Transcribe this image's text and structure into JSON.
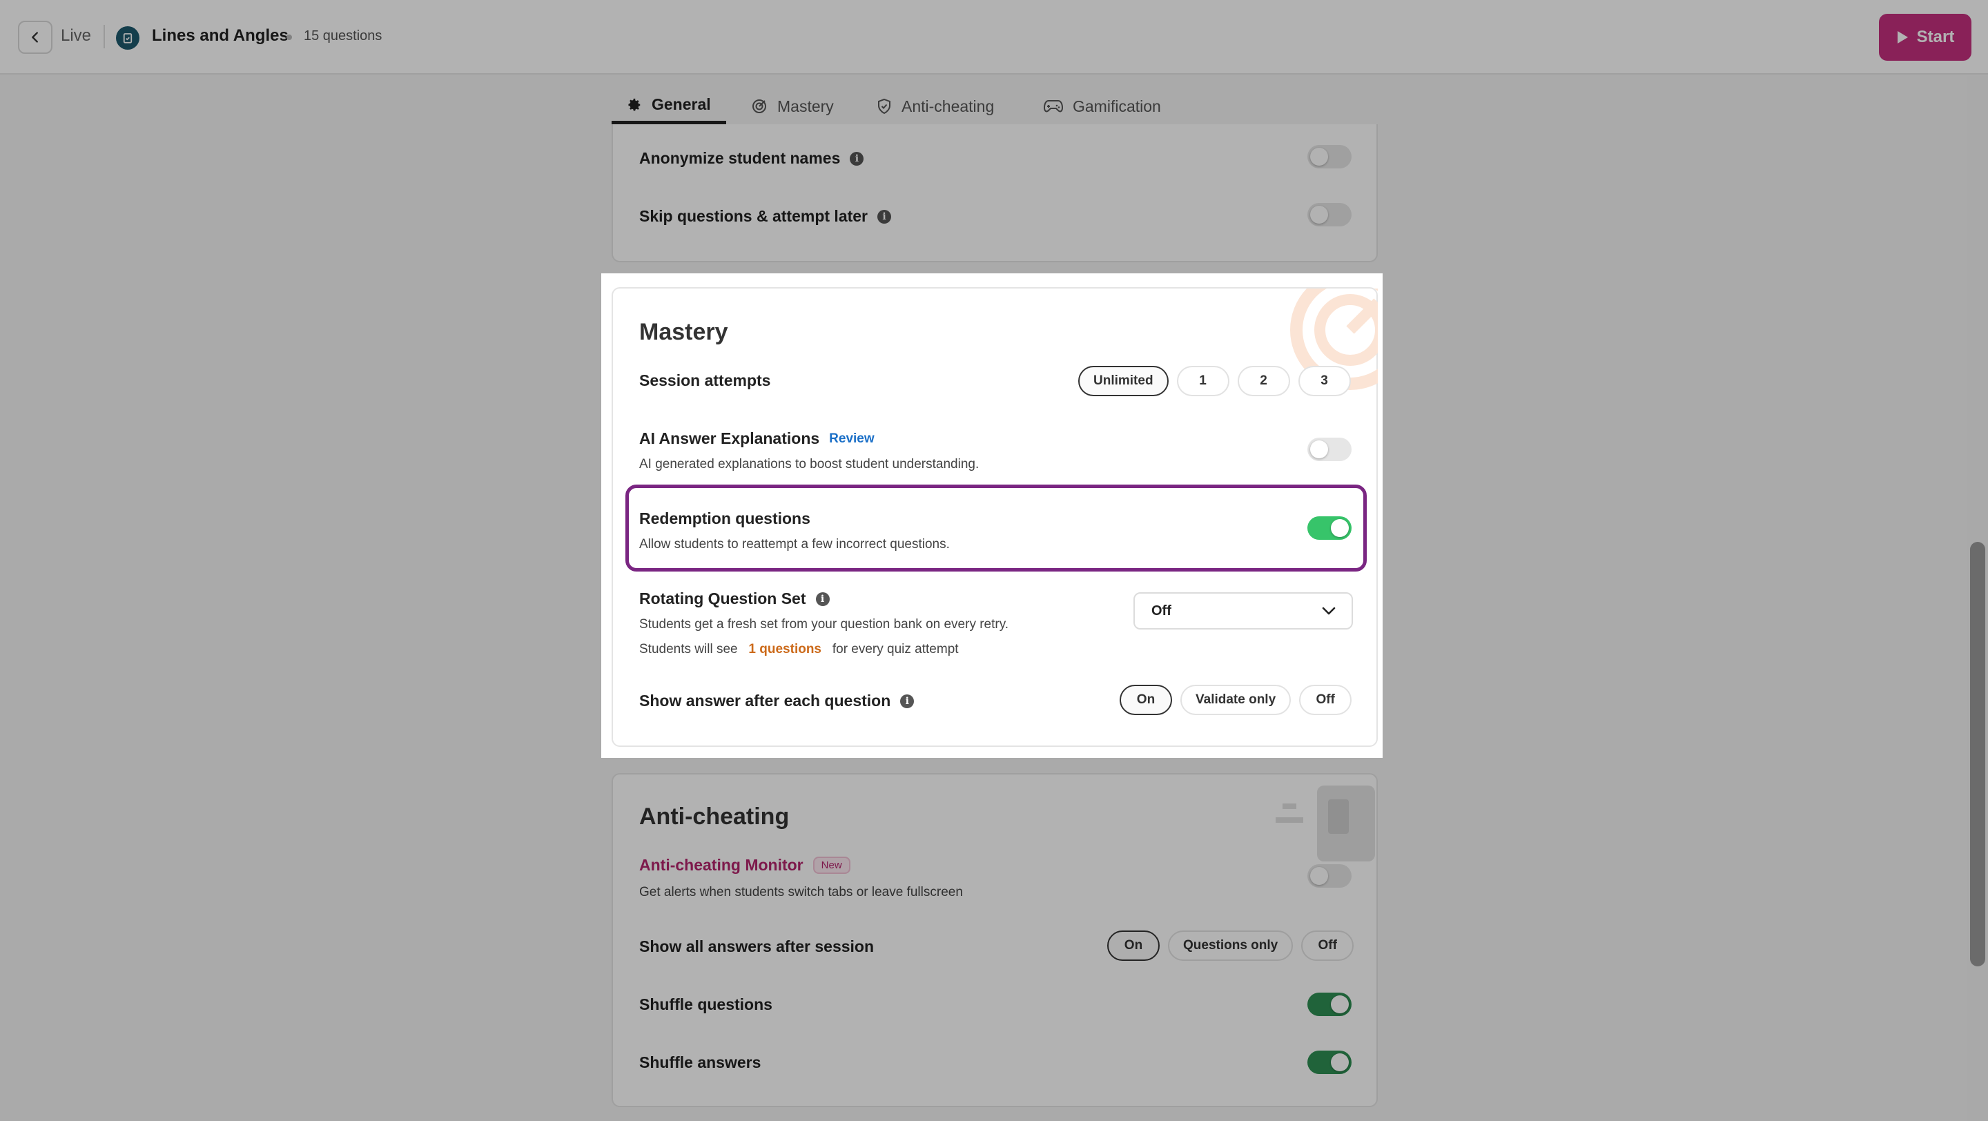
{
  "header": {
    "back_label": "Live",
    "quiz_title": "Lines and Angles",
    "question_count": "15 questions",
    "start_label": "Start"
  },
  "tabs": [
    {
      "label": "General",
      "icon": "gear-icon",
      "active": true
    },
    {
      "label": "Mastery",
      "icon": "target-icon",
      "active": false
    },
    {
      "label": "Anti-cheating",
      "icon": "shield-icon",
      "active": false
    },
    {
      "label": "Gamification",
      "icon": "gamepad-icon",
      "active": false
    }
  ],
  "general": {
    "anonymize_label": "Anonymize student names",
    "anonymize_on": false,
    "skip_label": "Skip questions & attempt later",
    "skip_on": false
  },
  "mastery": {
    "title": "Mastery",
    "session_attempts_label": "Session attempts",
    "session_attempts_options": [
      "Unlimited",
      "1",
      "2",
      "3"
    ],
    "session_attempts_selected": "Unlimited",
    "ai_label": "AI Answer Explanations",
    "ai_review_link": "Review",
    "ai_desc": "AI generated explanations to boost student understanding.",
    "ai_on": false,
    "redemption_label": "Redemption questions",
    "redemption_desc": "Allow students to reattempt a few incorrect questions.",
    "redemption_on": true,
    "rotating_label": "Rotating Question Set",
    "rotating_desc": "Students get a fresh set from your question bank on every retry.",
    "rotating_value": "Off",
    "rotating_see_prefix": "Students will see",
    "rotating_see_count": "1 questions",
    "rotating_see_suffix": "for every quiz attempt",
    "show_answer_label": "Show answer after each question",
    "show_answer_options": [
      "On",
      "Validate only",
      "Off"
    ],
    "show_answer_selected": "On"
  },
  "anticheating": {
    "title": "Anti-cheating",
    "monitor_label": "Anti-cheating Monitor",
    "monitor_badge": "New",
    "monitor_desc": "Get alerts when students switch tabs or leave fullscreen",
    "monitor_on": false,
    "show_all_label": "Show all answers after session",
    "show_all_options": [
      "On",
      "Questions only",
      "Off"
    ],
    "show_all_selected": "On",
    "shuffle_questions_label": "Shuffle questions",
    "shuffle_questions_on": true,
    "shuffle_answers_label": "Shuffle answers",
    "shuffle_answers_on": true
  },
  "colors": {
    "accent": "#c4307e",
    "toggle_on": "#2e8f53",
    "highlight": "#7a2682",
    "link": "#1a6fc7",
    "orange": "#cc6a1a"
  }
}
